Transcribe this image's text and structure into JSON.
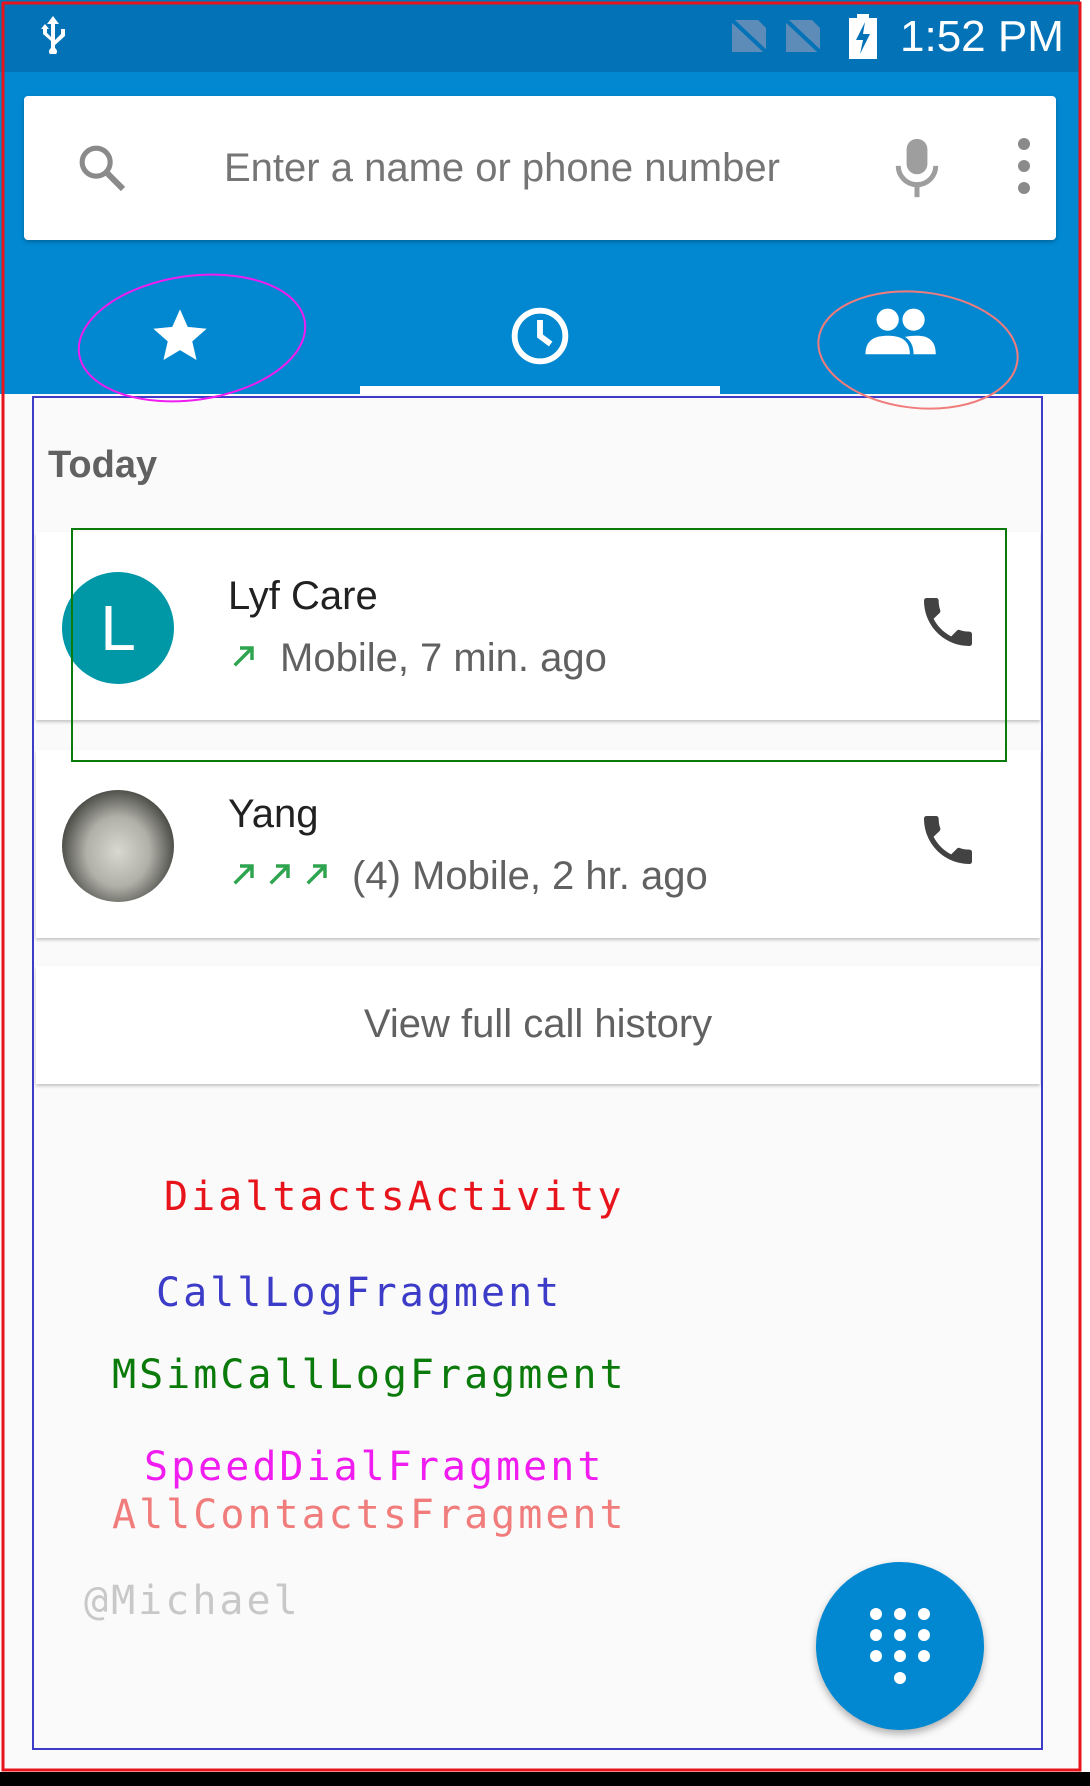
{
  "status_bar": {
    "time": "1:52 PM",
    "icons": [
      "usb-icon",
      "no-sim-icon",
      "no-sim-icon",
      "battery-charging-icon"
    ]
  },
  "search": {
    "placeholder": "Enter a name or phone number",
    "icons": [
      "search-icon",
      "mic-icon",
      "more-vert-icon"
    ]
  },
  "tabs": [
    {
      "icon": "star-icon",
      "selected": false
    },
    {
      "icon": "clock-icon",
      "selected": true
    },
    {
      "icon": "people-icon",
      "selected": false
    }
  ],
  "call_log": {
    "section_header": "Today",
    "entries": [
      {
        "avatar_letter": "L",
        "name": "Lyf Care",
        "detail": "Mobile, 7 min. ago",
        "call_type_icons": [
          "outgoing-call-icon"
        ]
      },
      {
        "name": "Yang",
        "detail": "(4) Mobile, 2 hr. ago",
        "call_type_icons": [
          "outgoing-call-icon",
          "outgoing-call-icon",
          "outgoing-call-icon"
        ]
      }
    ],
    "view_full_history": "View full call history"
  },
  "annotation_labels": {
    "dialtacts_activity": "DialtactsActivity",
    "call_log_fragment": "CallLogFragment",
    "msim_call_log_fragment": "MSimCallLogFragment",
    "speed_dial_fragment": "SpeedDialFragment",
    "all_contacts_fragment": "AllContactsFragment",
    "author": "@Michael"
  },
  "colors": {
    "app_bar": "#0288d1",
    "status_bar": "#0372b7",
    "avatar_teal": "#0097a7",
    "outgoing_arrow": "#2ea44f",
    "dialtacts_activity": "#e8141c",
    "call_log_fragment": "#3c3cc8",
    "msim_call_log_fragment": "#0a7a0a",
    "speed_dial_fragment": "#f01cf0",
    "all_contacts_fragment": "#f07c7c",
    "author": "#c8c8c8"
  }
}
